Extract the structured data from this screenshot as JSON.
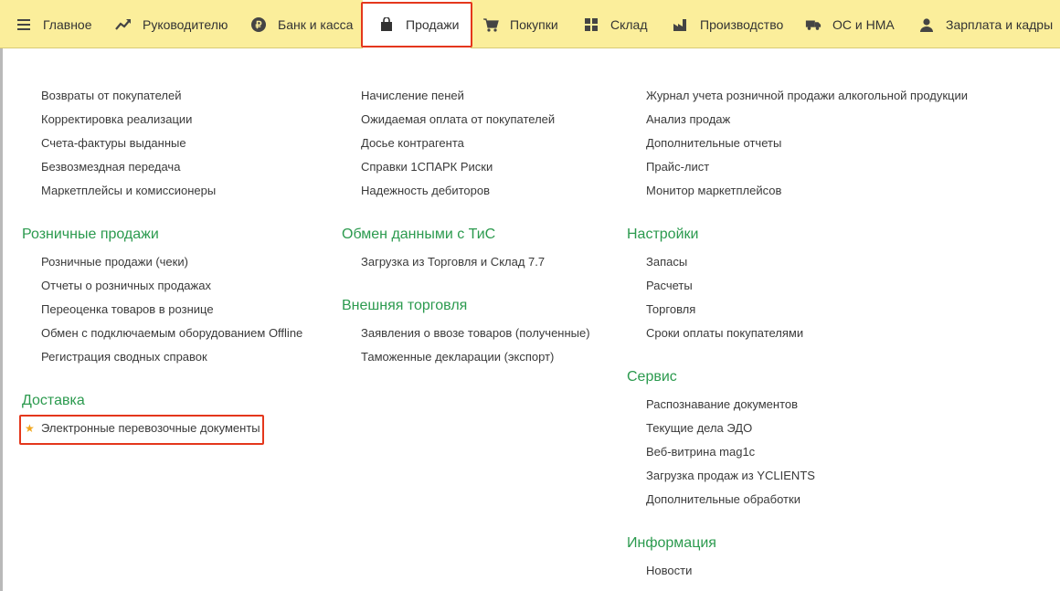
{
  "nav": {
    "items": [
      {
        "label": "Главное",
        "icon": "menu-icon"
      },
      {
        "label": "Руководителю",
        "icon": "trend-chart-icon"
      },
      {
        "label": "Банк и касса",
        "icon": "ruble-coin-icon"
      },
      {
        "label": "Продажи",
        "icon": "shopping-bag-icon",
        "active": true
      },
      {
        "label": "Покупки",
        "icon": "shopping-cart-icon"
      },
      {
        "label": "Склад",
        "icon": "warehouse-grid-icon"
      },
      {
        "label": "Производство",
        "icon": "factory-icon"
      },
      {
        "label": "ОС и НМА",
        "icon": "truck-icon"
      },
      {
        "label": "Зарплата и кадры",
        "icon": "person-icon"
      }
    ]
  },
  "col1": {
    "links_top": [
      "Возвраты от покупателей",
      "Корректировка реализации",
      "Счета-фактуры выданные",
      "Безвозмездная передача",
      "Маркетплейсы и комиссионеры"
    ],
    "retail": {
      "title": "Розничные продажи",
      "links": [
        "Розничные продажи (чеки)",
        "Отчеты о розничных продажах",
        "Переоценка товаров в рознице",
        "Обмен с подключаемым оборудованием Offline",
        "Регистрация сводных справок"
      ]
    },
    "delivery": {
      "title": "Доставка",
      "links": [
        "Электронные перевозочные документы"
      ]
    }
  },
  "col2": {
    "links_top": [
      "Начисление пеней",
      "Ожидаемая оплата от покупателей",
      "Досье контрагента",
      "Справки 1СПАРК Риски",
      "Надежность дебиторов"
    ],
    "exchange": {
      "title": "Обмен данными с ТиС",
      "links": [
        "Загрузка из Торговля и Склад 7.7"
      ]
    },
    "foreign": {
      "title": "Внешняя торговля",
      "links": [
        "Заявления о ввозе товаров (полученные)",
        "Таможенные декларации (экспорт)"
      ]
    }
  },
  "col3": {
    "links_top": [
      "Журнал учета розничной продажи алкогольной продукции",
      "Анализ продаж",
      "Дополнительные отчеты",
      "Прайс-лист",
      "Монитор маркетплейсов"
    ],
    "settings": {
      "title": "Настройки",
      "links": [
        "Запасы",
        "Расчеты",
        "Торговля",
        "Сроки оплаты покупателями"
      ]
    },
    "service": {
      "title": "Сервис",
      "links": [
        "Распознавание документов",
        "Текущие дела ЭДО",
        "Веб-витрина mag1c",
        "Загрузка продаж из YCLIENTS",
        "Дополнительные обработки"
      ]
    },
    "info": {
      "title": "Информация",
      "links": [
        "Новости"
      ]
    }
  },
  "colors": {
    "topbar_bg": "#fbee9b",
    "heading_green": "#2b9a4e",
    "highlight_red": "#e4371c",
    "star_orange": "#f1a61d"
  }
}
